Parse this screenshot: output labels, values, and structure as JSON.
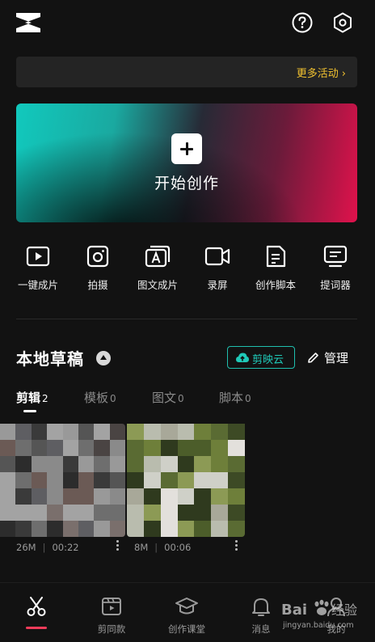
{
  "header": {
    "logo_icon": "capcut-logo-icon",
    "help_icon": "question-circle-icon",
    "settings_icon": "hex-gear-icon"
  },
  "banner": {
    "more_label": "更多活动",
    "accent": "#f2c230"
  },
  "hero": {
    "title": "开始创作"
  },
  "tools": [
    {
      "label": "一键成片",
      "icon": "play-frame-icon"
    },
    {
      "label": "拍摄",
      "icon": "camera-icon"
    },
    {
      "label": "图文成片",
      "icon": "text-image-icon"
    },
    {
      "label": "录屏",
      "icon": "video-record-icon"
    },
    {
      "label": "创作脚本",
      "icon": "script-doc-icon"
    },
    {
      "label": "提词器",
      "icon": "teleprompter-icon"
    }
  ],
  "drafts": {
    "title": "本地草稿",
    "cloud_label": "剪映云",
    "manage_label": "管理",
    "tabs": [
      {
        "label": "剪辑",
        "count": "2"
      },
      {
        "label": "模板",
        "count": "0"
      },
      {
        "label": "图文",
        "count": "0"
      },
      {
        "label": "脚本",
        "count": "0"
      }
    ],
    "items": [
      {
        "size": "26M",
        "duration": "00:22"
      },
      {
        "size": "8M",
        "duration": "00:06"
      }
    ]
  },
  "bottom_nav": {
    "items": [
      {
        "label": "",
        "icon": "scissors-icon"
      },
      {
        "label": "剪同款",
        "icon": "template-clapper-icon"
      },
      {
        "label": "创作课堂",
        "icon": "graduation-cap-icon"
      },
      {
        "label": "消息",
        "icon": "bell-icon"
      },
      {
        "label": "我的",
        "icon": "profile-icon"
      }
    ],
    "active_color": "#f23c5a"
  },
  "watermark": {
    "text": "jingyan.baidu.com"
  },
  "colors": {
    "background": "#121212",
    "teal": "#1fc9b8"
  }
}
